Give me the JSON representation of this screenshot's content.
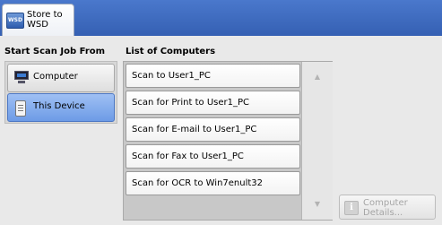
{
  "header": {
    "tab_title": "Store to WSD",
    "tab_icon": "WSD"
  },
  "left": {
    "heading": "Start Scan Job From",
    "options": [
      {
        "label": "Computer",
        "icon": "computer-icon",
        "selected": false
      },
      {
        "label": "This Device",
        "icon": "device-icon",
        "selected": true
      }
    ]
  },
  "right": {
    "heading": "List of Computers",
    "items": [
      "Scan to User1_PC",
      "Scan for Print to User1_PC",
      "Scan for E-mail to User1_PC",
      "Scan for Fax to User1_PC",
      "Scan for OCR to Win7enult32"
    ],
    "scroll_up": "▲",
    "scroll_down": "▼"
  },
  "details_button": {
    "label": "Computer Details...",
    "icon": "i",
    "enabled": false
  },
  "colors": {
    "header_bar": "#3f6cc0",
    "selected_option": "#7fa8ec"
  }
}
